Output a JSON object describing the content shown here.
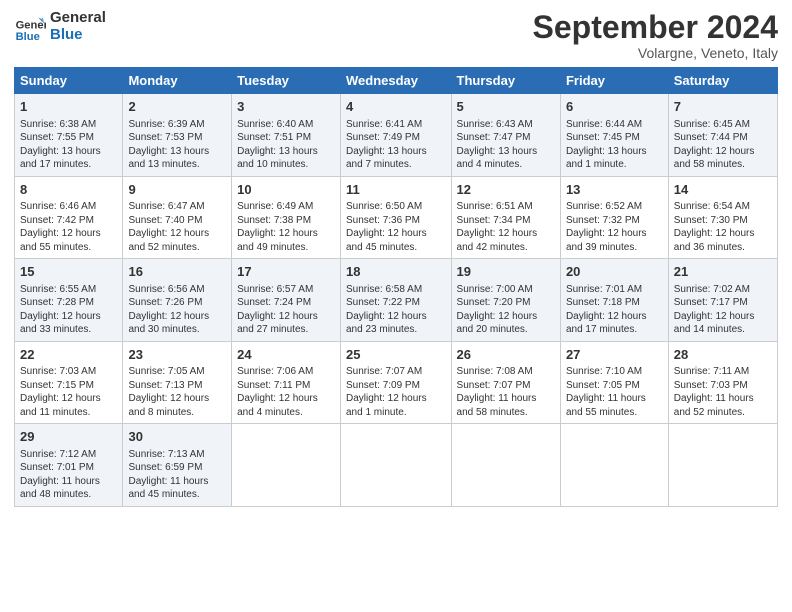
{
  "header": {
    "logo_line1": "General",
    "logo_line2": "Blue",
    "month": "September 2024",
    "location": "Volargne, Veneto, Italy"
  },
  "columns": [
    "Sunday",
    "Monday",
    "Tuesday",
    "Wednesday",
    "Thursday",
    "Friday",
    "Saturday"
  ],
  "weeks": [
    [
      {
        "day": "1",
        "info": "Sunrise: 6:38 AM\nSunset: 7:55 PM\nDaylight: 13 hours\nand 17 minutes."
      },
      {
        "day": "2",
        "info": "Sunrise: 6:39 AM\nSunset: 7:53 PM\nDaylight: 13 hours\nand 13 minutes."
      },
      {
        "day": "3",
        "info": "Sunrise: 6:40 AM\nSunset: 7:51 PM\nDaylight: 13 hours\nand 10 minutes."
      },
      {
        "day": "4",
        "info": "Sunrise: 6:41 AM\nSunset: 7:49 PM\nDaylight: 13 hours\nand 7 minutes."
      },
      {
        "day": "5",
        "info": "Sunrise: 6:43 AM\nSunset: 7:47 PM\nDaylight: 13 hours\nand 4 minutes."
      },
      {
        "day": "6",
        "info": "Sunrise: 6:44 AM\nSunset: 7:45 PM\nDaylight: 13 hours\nand 1 minute."
      },
      {
        "day": "7",
        "info": "Sunrise: 6:45 AM\nSunset: 7:44 PM\nDaylight: 12 hours\nand 58 minutes."
      }
    ],
    [
      {
        "day": "8",
        "info": "Sunrise: 6:46 AM\nSunset: 7:42 PM\nDaylight: 12 hours\nand 55 minutes."
      },
      {
        "day": "9",
        "info": "Sunrise: 6:47 AM\nSunset: 7:40 PM\nDaylight: 12 hours\nand 52 minutes."
      },
      {
        "day": "10",
        "info": "Sunrise: 6:49 AM\nSunset: 7:38 PM\nDaylight: 12 hours\nand 49 minutes."
      },
      {
        "day": "11",
        "info": "Sunrise: 6:50 AM\nSunset: 7:36 PM\nDaylight: 12 hours\nand 45 minutes."
      },
      {
        "day": "12",
        "info": "Sunrise: 6:51 AM\nSunset: 7:34 PM\nDaylight: 12 hours\nand 42 minutes."
      },
      {
        "day": "13",
        "info": "Sunrise: 6:52 AM\nSunset: 7:32 PM\nDaylight: 12 hours\nand 39 minutes."
      },
      {
        "day": "14",
        "info": "Sunrise: 6:54 AM\nSunset: 7:30 PM\nDaylight: 12 hours\nand 36 minutes."
      }
    ],
    [
      {
        "day": "15",
        "info": "Sunrise: 6:55 AM\nSunset: 7:28 PM\nDaylight: 12 hours\nand 33 minutes."
      },
      {
        "day": "16",
        "info": "Sunrise: 6:56 AM\nSunset: 7:26 PM\nDaylight: 12 hours\nand 30 minutes."
      },
      {
        "day": "17",
        "info": "Sunrise: 6:57 AM\nSunset: 7:24 PM\nDaylight: 12 hours\nand 27 minutes."
      },
      {
        "day": "18",
        "info": "Sunrise: 6:58 AM\nSunset: 7:22 PM\nDaylight: 12 hours\nand 23 minutes."
      },
      {
        "day": "19",
        "info": "Sunrise: 7:00 AM\nSunset: 7:20 PM\nDaylight: 12 hours\nand 20 minutes."
      },
      {
        "day": "20",
        "info": "Sunrise: 7:01 AM\nSunset: 7:18 PM\nDaylight: 12 hours\nand 17 minutes."
      },
      {
        "day": "21",
        "info": "Sunrise: 7:02 AM\nSunset: 7:17 PM\nDaylight: 12 hours\nand 14 minutes."
      }
    ],
    [
      {
        "day": "22",
        "info": "Sunrise: 7:03 AM\nSunset: 7:15 PM\nDaylight: 12 hours\nand 11 minutes."
      },
      {
        "day": "23",
        "info": "Sunrise: 7:05 AM\nSunset: 7:13 PM\nDaylight: 12 hours\nand 8 minutes."
      },
      {
        "day": "24",
        "info": "Sunrise: 7:06 AM\nSunset: 7:11 PM\nDaylight: 12 hours\nand 4 minutes."
      },
      {
        "day": "25",
        "info": "Sunrise: 7:07 AM\nSunset: 7:09 PM\nDaylight: 12 hours\nand 1 minute."
      },
      {
        "day": "26",
        "info": "Sunrise: 7:08 AM\nSunset: 7:07 PM\nDaylight: 11 hours\nand 58 minutes."
      },
      {
        "day": "27",
        "info": "Sunrise: 7:10 AM\nSunset: 7:05 PM\nDaylight: 11 hours\nand 55 minutes."
      },
      {
        "day": "28",
        "info": "Sunrise: 7:11 AM\nSunset: 7:03 PM\nDaylight: 11 hours\nand 52 minutes."
      }
    ],
    [
      {
        "day": "29",
        "info": "Sunrise: 7:12 AM\nSunset: 7:01 PM\nDaylight: 11 hours\nand 48 minutes."
      },
      {
        "day": "30",
        "info": "Sunrise: 7:13 AM\nSunset: 6:59 PM\nDaylight: 11 hours\nand 45 minutes."
      },
      {
        "day": "",
        "info": ""
      },
      {
        "day": "",
        "info": ""
      },
      {
        "day": "",
        "info": ""
      },
      {
        "day": "",
        "info": ""
      },
      {
        "day": "",
        "info": ""
      }
    ]
  ]
}
